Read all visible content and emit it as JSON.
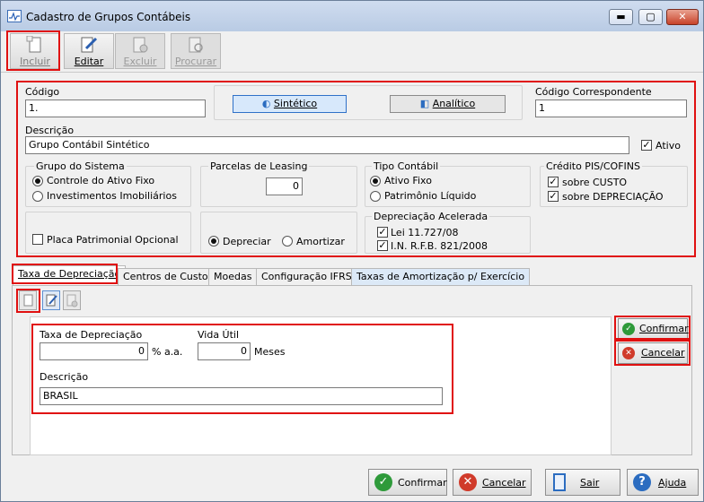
{
  "window": {
    "title": "Cadastro de Grupos Contábeis",
    "min": "▬",
    "max": "▢",
    "close": "✕"
  },
  "toolbar": {
    "incluir": "Incluir",
    "editar": "Editar",
    "excluir": "Excluir",
    "procurar": "Procurar"
  },
  "form": {
    "codigo_label": "Código",
    "codigo_value": "1.",
    "sintetico": "Sintético",
    "analitico": "Analítico",
    "cod_corresp_label": "Código Correspondente",
    "cod_corresp_value": "1",
    "descricao_label": "Descrição",
    "descricao_value": "Grupo Contábil Sintético",
    "ativo_label": "Ativo",
    "grupo_sistema_title": "Grupo do Sistema",
    "grupo_sistema_opt1": "Controle do Ativo Fixo",
    "grupo_sistema_opt2": "Investimentos Imobiliários",
    "parcelas_title": "Parcelas de Leasing",
    "parcelas_value": "0",
    "tipo_contabil_title": "Tipo Contábil",
    "tipo_opt1": "Ativo Fixo",
    "tipo_opt2": "Patrimônio Líquido",
    "credito_title": "Crédito PIS/COFINS",
    "credito_opt1": "sobre CUSTO",
    "credito_opt2": "sobre DEPRECIAÇÃO",
    "placa_label": "Placa Patrimonial Opcional",
    "depreciar": "Depreciar",
    "amortizar": "Amortizar",
    "deprec_acel_title": "Depreciação Acelerada",
    "lei": "Lei 11.727/08",
    "in_rfb": "I.N. R.F.B. 821/2008"
  },
  "tabs": [
    "Taxa de Depreciação",
    "Centros de Custo",
    "Moedas",
    "Configuração IFRS",
    "Taxas de Amortização p/ Exercício"
  ],
  "detail": {
    "taxa_label": "Taxa de Depreciação",
    "taxa_value": "0",
    "taxa_unit": "% a.a.",
    "vida_label": "Vida Útil",
    "vida_value": "0",
    "vida_unit": "Meses",
    "descricao_label": "Descrição",
    "descricao_value": "BRASIL",
    "confirmar": "Confirmar",
    "cancelar": "Cancelar"
  },
  "footer": {
    "confirmar": "Confirmar",
    "cancelar": "Cancelar",
    "sair": "Sair",
    "ajuda": "Ajuda"
  },
  "colors": {
    "highlight": "#e01010",
    "confirm": "#2e9a3a",
    "cancel": "#d03a2a",
    "help": "#2b6cc0"
  }
}
